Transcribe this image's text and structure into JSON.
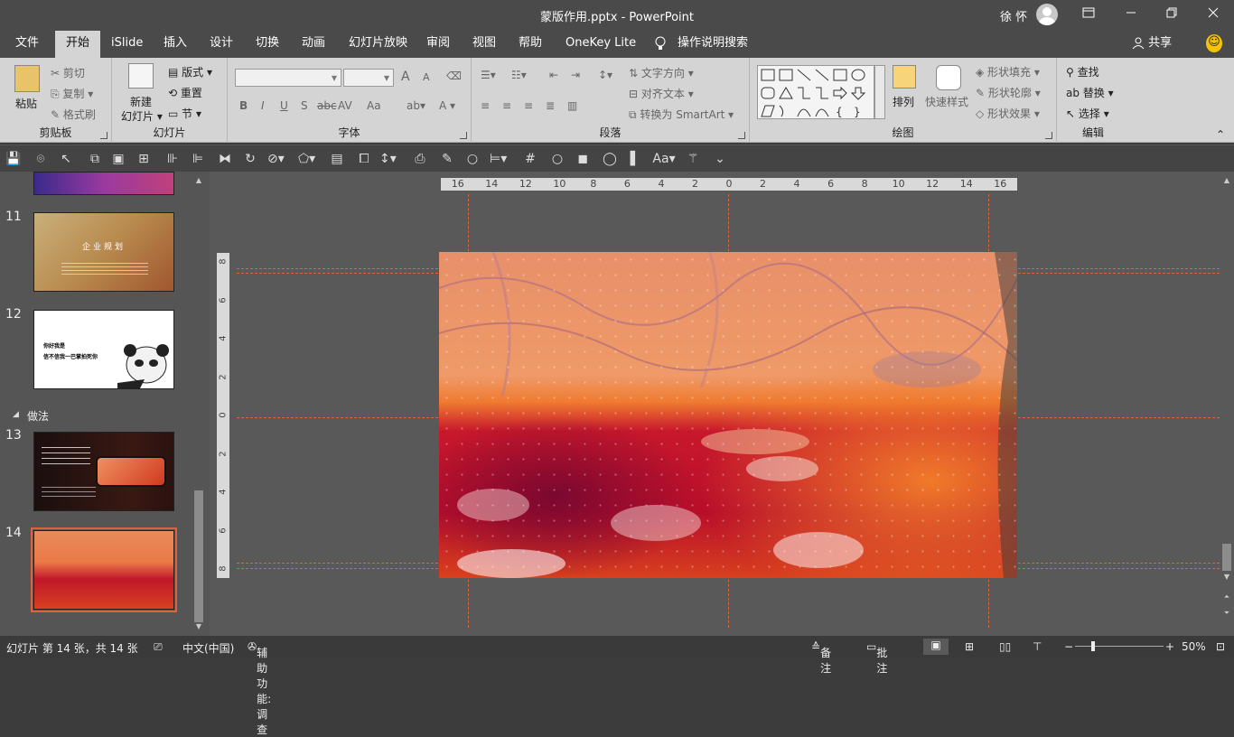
{
  "window": {
    "title": "蒙版作用.pptx  -  PowerPoint",
    "user": "徐 怀"
  },
  "tabs": [
    "文件",
    "开始",
    "iSlide",
    "插入",
    "设计",
    "切换",
    "动画",
    "幻灯片放映",
    "审阅",
    "视图",
    "帮助",
    "OneKey Lite",
    "操作说明搜索"
  ],
  "share_label": "共享",
  "ribbon": {
    "clipboard": {
      "label": "剪贴板",
      "paste": "粘贴",
      "cut": "剪切",
      "copy": "复制",
      "format_painter": "格式刷"
    },
    "slides": {
      "label": "幻灯片",
      "new_slide_1": "新建",
      "new_slide_2": "幻灯片",
      "layout": "版式",
      "reset": "重置",
      "section": "节"
    },
    "font": {
      "label": "字体",
      "bold": "B",
      "italic": "I",
      "underline": "U",
      "shadow": "S",
      "strike": "abc",
      "spacing": "AV",
      "case": "Aa",
      "grow": "A",
      "shrink": "A",
      "color": "A"
    },
    "paragraph": {
      "label": "段落",
      "text_direction": "文字方向",
      "align_text": "对齐文本",
      "smartart": "转换为 SmartArt"
    },
    "drawing": {
      "label": "绘图",
      "arrange": "排列",
      "quick_styles": "快速样式",
      "fill": "形状填充",
      "outline": "形状轮廓",
      "effects": "形状效果"
    },
    "editing": {
      "label": "编辑",
      "find": "查找",
      "replace": "替换",
      "select": "选择"
    }
  },
  "thumbnails": {
    "items": [
      {
        "num": "11",
        "title": "企业规划"
      },
      {
        "num": "12",
        "line1": "你好我是",
        "line2": "信不信我一巴掌拍死你"
      },
      {
        "num": "13"
      },
      {
        "num": "14"
      }
    ],
    "section_label": "做法"
  },
  "ruler": {
    "h_ticks": [
      "16",
      "14",
      "12",
      "10",
      "8",
      "6",
      "4",
      "2",
      "0",
      "2",
      "4",
      "6",
      "8",
      "10",
      "12",
      "14",
      "16"
    ],
    "v_ticks": [
      "8",
      "6",
      "4",
      "2",
      "0",
      "2",
      "4",
      "6",
      "8"
    ]
  },
  "status": {
    "slide_info": "幻灯片 第 14 张，共 14 张",
    "language": "中文(中国)",
    "accessibility": "辅助功能: 调查",
    "notes": "备注",
    "comments": "批注",
    "zoom": "50%"
  },
  "colors": {
    "accent": "#e0623a",
    "ribbon_bg": "#d4d4d4",
    "title_bg": "#4a4a4a"
  }
}
